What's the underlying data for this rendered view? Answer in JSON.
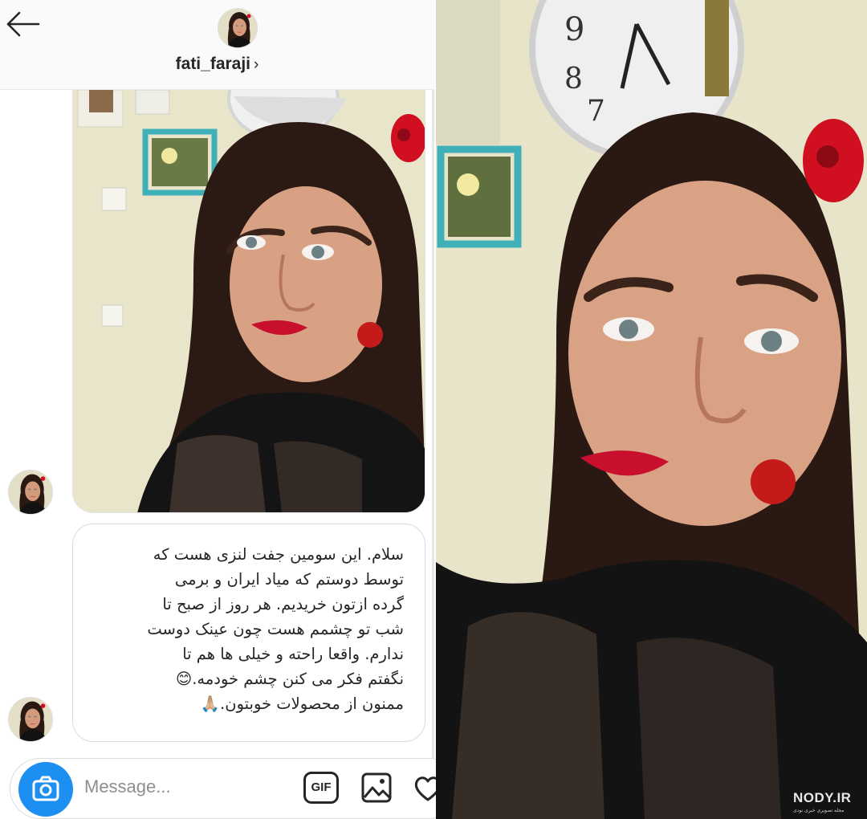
{
  "header": {
    "username": "fati_faraji",
    "chevron": "›"
  },
  "messages": {
    "text": "سلام. این سومین جفت لنزی هست که\nتوسط دوستم که میاد ایران و برمی\nگرده ازتون خریدیم. هر روز از صبح تا\nشب تو چشمم هست چون عینک دوست\nندارم. واقعا راحته و خیلی ها هم تا\nنگفتم فکر می کنن چشم خودمه.😊\nممنون از محصولات خوبتون.🙏🏼"
  },
  "composer": {
    "placeholder": "Message...",
    "gif_label": "GIF"
  },
  "watermark": {
    "brand": "NODY.IR",
    "tagline": "مجله تصویری خبری نودی"
  },
  "colors": {
    "accent": "#1d8ff2",
    "text": "#262626",
    "muted": "#8e8e8e",
    "lipstick": "#c8102e",
    "flower": "#d01020"
  },
  "icons": [
    "back-arrow-icon",
    "chevron-right-icon",
    "camera-icon",
    "gif-icon",
    "gallery-icon",
    "heart-icon"
  ]
}
